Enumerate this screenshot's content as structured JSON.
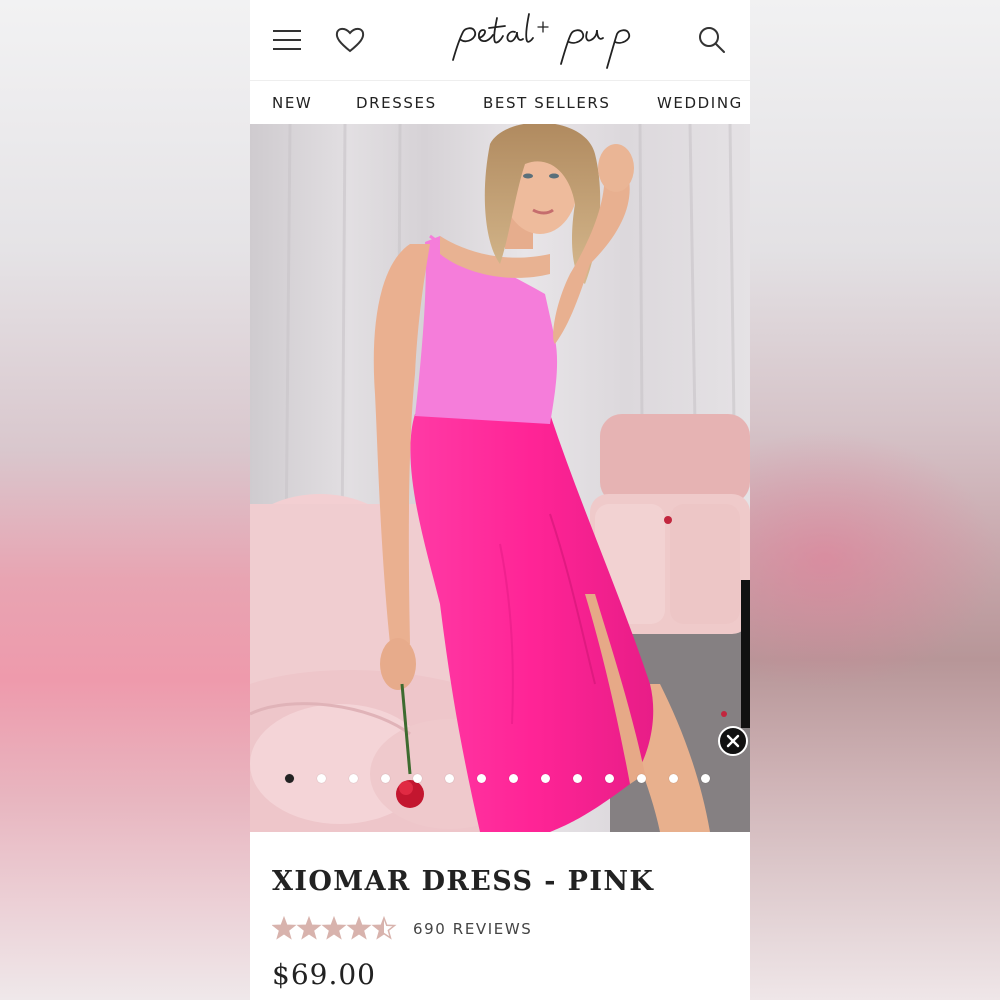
{
  "brand": {
    "logo_text": "petal + pup"
  },
  "nav": {
    "items": [
      {
        "label": "NEW"
      },
      {
        "label": "DRESSES"
      },
      {
        "label": "BEST SELLERS"
      },
      {
        "label": "WEDDING"
      }
    ]
  },
  "gallery": {
    "image_count": 14,
    "active_index": 0
  },
  "product": {
    "title": "XIOMAR DRESS - PINK",
    "rating": 4.5,
    "rating_max": 5,
    "reviews_label": "690 REVIEWS",
    "price": "$69.00"
  },
  "icons": {
    "menu": "hamburger-menu-icon",
    "wishlist": "heart-icon",
    "search": "search-icon",
    "close": "close-icon",
    "star": "star-icon"
  },
  "colors": {
    "star": "#d8b3ad",
    "dress_top": "#f27ad8",
    "dress_skirt": "#ff2f9a",
    "active_dot": "#222222"
  }
}
